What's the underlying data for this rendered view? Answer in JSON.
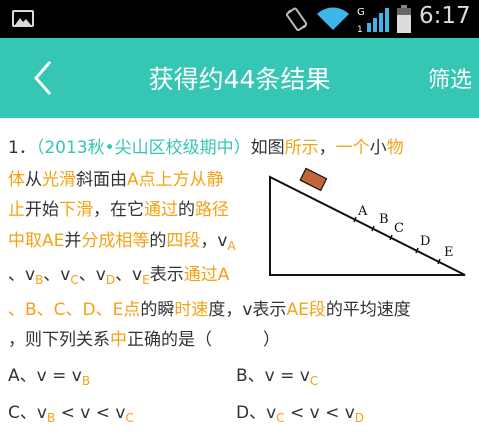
{
  "status_bar": {
    "time": "6:17",
    "signal_badge": "G",
    "signal_sub": "1",
    "icons": [
      "picture-icon",
      "vibrate-icon",
      "wifi-icon",
      "signal-icon",
      "battery-icon"
    ]
  },
  "app_bar": {
    "back_icon": "chevron-left-icon",
    "title": "获得约44条结果",
    "filter_label": "筛选",
    "color": "#35c6b4"
  },
  "question": {
    "number": "1．",
    "source": "（2013秋•尖山区校级期中）",
    "text": {
      "l1_a": "如图",
      "l1_b": "所示",
      "l1_c": "，",
      "l1_d": "一个",
      "l1_e": "小",
      "l1_f": "物",
      "l2_a": "体",
      "l2_b": "从",
      "l2_c": "光滑",
      "l2_d": "斜面由",
      "l2_e": "A点上方从静",
      "l3_a": "止",
      "l3_b": "开始",
      "l3_c": "下滑",
      "l3_d": "，在它",
      "l3_e": "通过",
      "l3_f": "的",
      "l3_g": "路径",
      "l4_a": "中取AE",
      "l4_b": "并",
      "l4_c": "分成相等",
      "l4_d": "的",
      "l4_e": "四段",
      "l4_f": "，v",
      "l4_g": "A",
      "l5_a": "、v",
      "l5_b": "B",
      "l5_c": "、v",
      "l5_d": "C",
      "l5_e": "、v",
      "l5_f": "D",
      "l5_g": "、v",
      "l5_h": "E",
      "l5_i": "表示",
      "l5_j": "通过A",
      "l6_a": "、B、C、D、E点",
      "l6_b": "的瞬",
      "l6_c": "时速",
      "l6_d": "度，v表示",
      "l6_e": "AE段",
      "l6_f": "的平均速度",
      "l7_a": "，则下列关系",
      "l7_b": "中",
      "l7_c": "正确的是（　　　）"
    },
    "figure_labels": [
      "A",
      "B",
      "C",
      "D",
      "E"
    ],
    "options": [
      {
        "prefix": "A、v = v",
        "sub": "B",
        "suffix": ""
      },
      {
        "prefix": "B、v = v",
        "sub": "C",
        "suffix": ""
      },
      {
        "prefix": "C、v",
        "sub": "B",
        "mid": " < v < v",
        "sub2": "C"
      },
      {
        "prefix": "D、v",
        "sub": "C",
        "mid": " < v < v",
        "sub2": "D"
      }
    ]
  },
  "colors": {
    "orange_keyword": "#f5a213",
    "teal_source": "#35c6b4",
    "block": "#c0663a"
  }
}
